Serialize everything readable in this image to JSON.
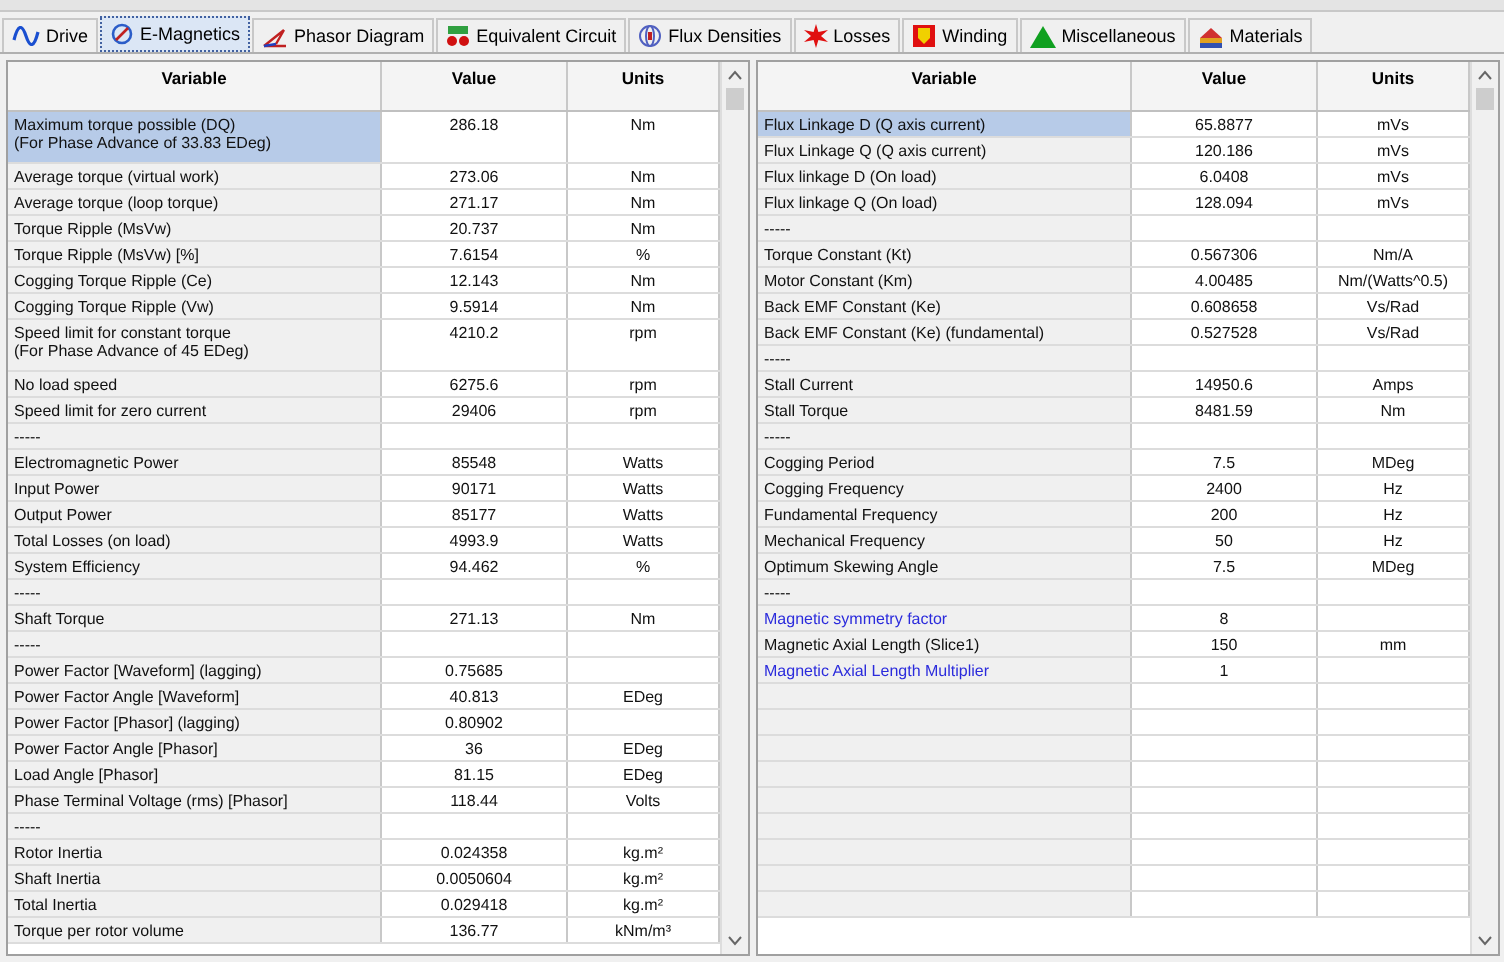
{
  "tabs": [
    {
      "label": "Drive",
      "selected": false
    },
    {
      "label": "E-Magnetics",
      "selected": true
    },
    {
      "label": "Phasor Diagram",
      "selected": false
    },
    {
      "label": "Equivalent Circuit",
      "selected": false
    },
    {
      "label": "Flux Densities",
      "selected": false
    },
    {
      "label": "Losses",
      "selected": false
    },
    {
      "label": "Winding",
      "selected": false
    },
    {
      "label": "Miscellaneous",
      "selected": false
    },
    {
      "label": "Materials",
      "selected": false
    }
  ],
  "tables": [
    {
      "columns": [
        "Variable",
        "Value",
        "Units"
      ],
      "rows": [
        {
          "variable": "Maximum torque possible (DQ)",
          "note": "(For Phase Advance of 33.83 EDeg)",
          "value": "286.18",
          "units": "Nm",
          "selected": true,
          "link": false
        },
        {
          "variable": "Average torque (virtual work)",
          "value": "273.06",
          "units": "Nm",
          "selected": false,
          "link": false
        },
        {
          "variable": "Average torque (loop torque)",
          "value": "271.17",
          "units": "Nm",
          "selected": false,
          "link": false
        },
        {
          "variable": "Torque Ripple (MsVw)",
          "value": "20.737",
          "units": "Nm",
          "selected": false,
          "link": false
        },
        {
          "variable": "Torque Ripple (MsVw) [%]",
          "value": "7.6154",
          "units": "%",
          "selected": false,
          "link": false
        },
        {
          "variable": "Cogging Torque Ripple (Ce)",
          "value": "12.143",
          "units": "Nm",
          "selected": false,
          "link": false
        },
        {
          "variable": "Cogging Torque Ripple (Vw)",
          "value": "9.5914",
          "units": "Nm",
          "selected": false,
          "link": false
        },
        {
          "variable": "Speed limit for constant torque",
          "note": "(For Phase Advance of 45 EDeg)",
          "value": "4210.2",
          "units": "rpm",
          "selected": false,
          "link": false
        },
        {
          "variable": "No load speed",
          "value": "6275.6",
          "units": "rpm",
          "selected": false,
          "link": false
        },
        {
          "variable": "Speed limit for zero current",
          "value": "29406",
          "units": "rpm",
          "selected": false,
          "link": false
        },
        {
          "variable": "-----",
          "selected": false,
          "link": false
        },
        {
          "variable": "Electromagnetic Power",
          "value": "85548",
          "units": "Watts",
          "selected": false,
          "link": false
        },
        {
          "variable": "Input Power",
          "value": "90171",
          "units": "Watts",
          "selected": false,
          "link": false
        },
        {
          "variable": "Output Power",
          "value": "85177",
          "units": "Watts",
          "selected": false,
          "link": false
        },
        {
          "variable": "Total Losses (on load)",
          "value": "4993.9",
          "units": "Watts",
          "selected": false,
          "link": false
        },
        {
          "variable": "System Efficiency",
          "value": "94.462",
          "units": "%",
          "selected": false,
          "link": false
        },
        {
          "variable": "-----",
          "selected": false,
          "link": false
        },
        {
          "variable": "Shaft Torque",
          "value": "271.13",
          "units": "Nm",
          "selected": false,
          "link": false
        },
        {
          "variable": "-----",
          "selected": false,
          "link": false
        },
        {
          "variable": "Power Factor [Waveform] (lagging)",
          "value": "0.75685",
          "selected": false,
          "link": false
        },
        {
          "variable": "Power Factor Angle [Waveform]",
          "value": "40.813",
          "units": "EDeg",
          "selected": false,
          "link": false
        },
        {
          "variable": "Power Factor [Phasor] (lagging)",
          "value": "0.80902",
          "selected": false,
          "link": false
        },
        {
          "variable": "Power Factor Angle [Phasor]",
          "value": "36",
          "units": "EDeg",
          "selected": false,
          "link": false
        },
        {
          "variable": "Load Angle [Phasor]",
          "value": "81.15",
          "units": "EDeg",
          "selected": false,
          "link": false
        },
        {
          "variable": "Phase Terminal Voltage (rms) [Phasor]",
          "value": "118.44",
          "units": "Volts",
          "selected": false,
          "link": false
        },
        {
          "variable": "-----",
          "selected": false,
          "link": false
        },
        {
          "variable": "Rotor Inertia",
          "value": "0.024358",
          "units": "kg.m²",
          "selected": false,
          "link": false
        },
        {
          "variable": "Shaft Inertia",
          "value": "0.0050604",
          "units": "kg.m²",
          "selected": false,
          "link": false
        },
        {
          "variable": "Total Inertia",
          "value": "0.029418",
          "units": "kg.m²",
          "selected": false,
          "link": false
        },
        {
          "variable": "Torque per rotor volume",
          "value": "136.77",
          "units": "kNm/m³",
          "selected": false,
          "link": false
        }
      ]
    },
    {
      "columns": [
        "Variable",
        "Value",
        "Units"
      ],
      "rows": [
        {
          "variable": "Flux Linkage D (Q axis current)",
          "value": "65.8877",
          "units": "mVs",
          "selected": true,
          "link": false
        },
        {
          "variable": "Flux Linkage Q (Q axis current)",
          "value": "120.186",
          "units": "mVs",
          "selected": false,
          "link": false
        },
        {
          "variable": "Flux linkage D (On load)",
          "value": "6.0408",
          "units": "mVs",
          "selected": false,
          "link": false
        },
        {
          "variable": "Flux linkage Q (On load)",
          "value": "128.094",
          "units": "mVs",
          "selected": false,
          "link": false
        },
        {
          "variable": "-----",
          "selected": false,
          "link": false
        },
        {
          "variable": "Torque Constant (Kt)",
          "value": "0.567306",
          "units": "Nm/A",
          "selected": false,
          "link": false
        },
        {
          "variable": "Motor Constant (Km)",
          "value": "4.00485",
          "units": "Nm/(Watts^0.5)",
          "selected": false,
          "link": false
        },
        {
          "variable": "Back EMF Constant (Ke)",
          "value": "0.608658",
          "units": "Vs/Rad",
          "selected": false,
          "link": false
        },
        {
          "variable": "Back EMF Constant (Ke) (fundamental)",
          "value": "0.527528",
          "units": "Vs/Rad",
          "selected": false,
          "link": false
        },
        {
          "variable": "-----",
          "selected": false,
          "link": false
        },
        {
          "variable": "Stall Current",
          "value": "14950.6",
          "units": "Amps",
          "selected": false,
          "link": false
        },
        {
          "variable": "Stall Torque",
          "value": "8481.59",
          "units": "Nm",
          "selected": false,
          "link": false
        },
        {
          "variable": "-----",
          "selected": false,
          "link": false
        },
        {
          "variable": "Cogging Period",
          "value": "7.5",
          "units": "MDeg",
          "selected": false,
          "link": false
        },
        {
          "variable": "Cogging Frequency",
          "value": "2400",
          "units": "Hz",
          "selected": false,
          "link": false
        },
        {
          "variable": "Fundamental Frequency",
          "value": "200",
          "units": "Hz",
          "selected": false,
          "link": false
        },
        {
          "variable": "Mechanical Frequency",
          "value": "50",
          "units": "Hz",
          "selected": false,
          "link": false
        },
        {
          "variable": "Optimum Skewing Angle",
          "value": "7.5",
          "units": "MDeg",
          "selected": false,
          "link": false
        },
        {
          "variable": "-----",
          "selected": false,
          "link": false
        },
        {
          "variable": "Magnetic symmetry factor",
          "value": "8",
          "selected": false,
          "link": true
        },
        {
          "variable": "Magnetic Axial Length (Slice1)",
          "value": "150",
          "units": "mm",
          "selected": false,
          "link": false
        },
        {
          "variable": "Magnetic Axial Length Multiplier",
          "value": "1",
          "selected": false,
          "link": true
        }
      ]
    }
  ]
}
